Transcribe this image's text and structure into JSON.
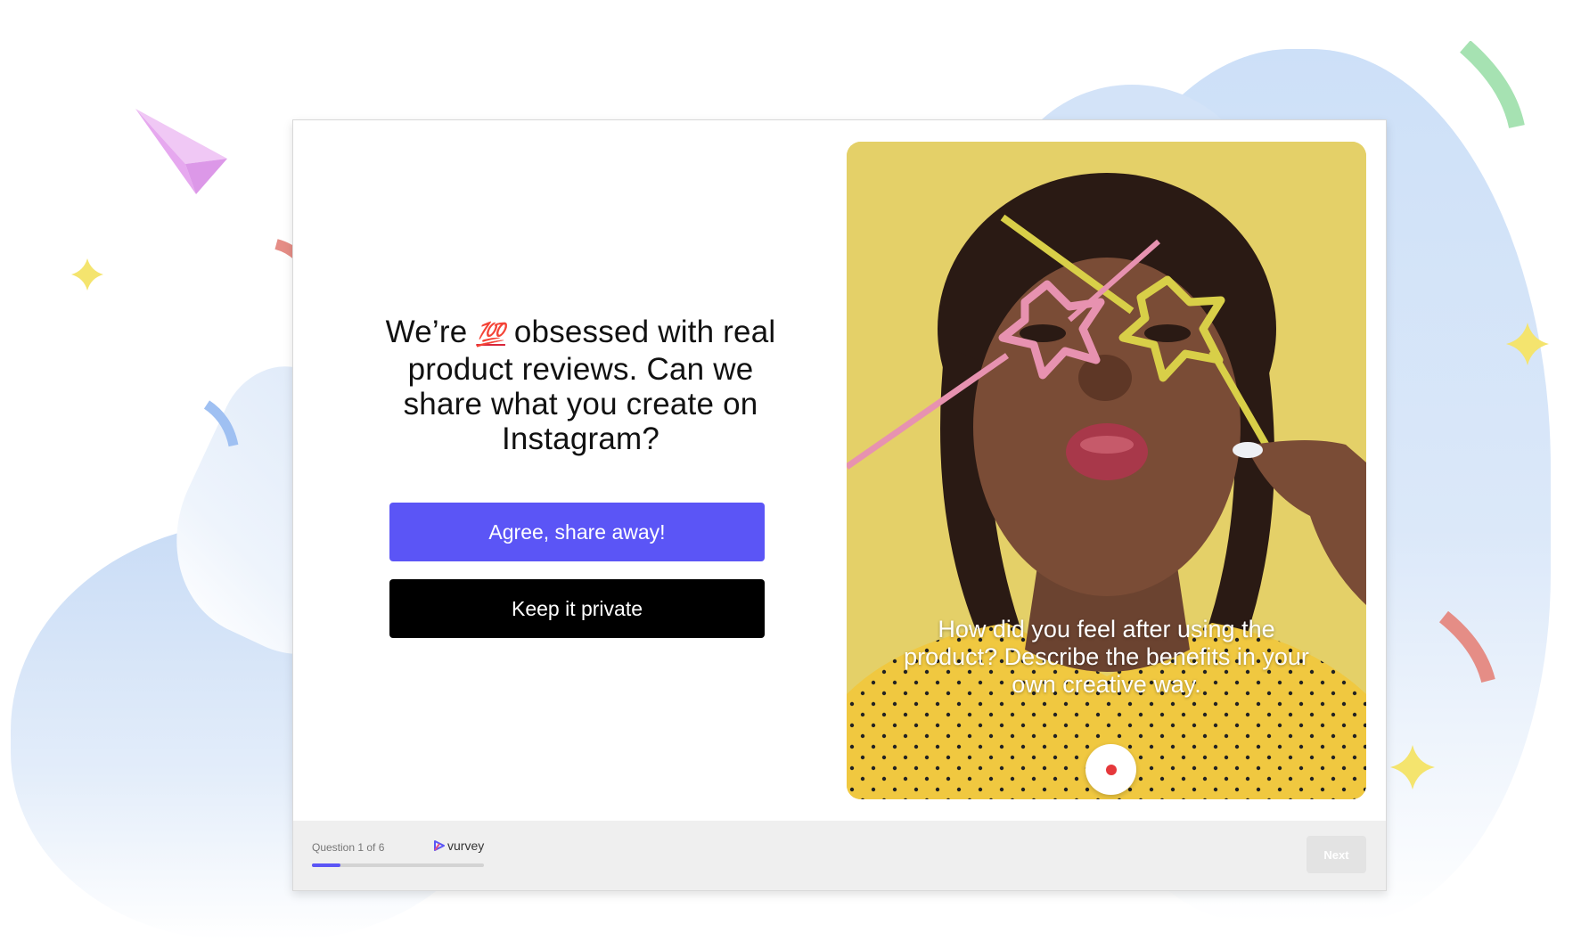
{
  "question": {
    "text_before": "We’re ",
    "emoji": "💯",
    "text_after": " obsessed with real product reviews. Can we share what you create on Instagram?"
  },
  "buttons": {
    "agree": "Agree, share away!",
    "private": "Keep it private"
  },
  "media": {
    "caption": "How did you feel after using the product? Describe the benefits in your own creative way.",
    "record_icon": "record-dot-icon"
  },
  "footer": {
    "progress_label": "Question 1 of 6",
    "progress_value": 0.1667,
    "brand": "vurvey",
    "next_label": "Next"
  },
  "colors": {
    "accent": "#5b55f6",
    "primary_dark": "#000000",
    "record": "#e5383b",
    "backdrop": "#e3cf5a"
  }
}
